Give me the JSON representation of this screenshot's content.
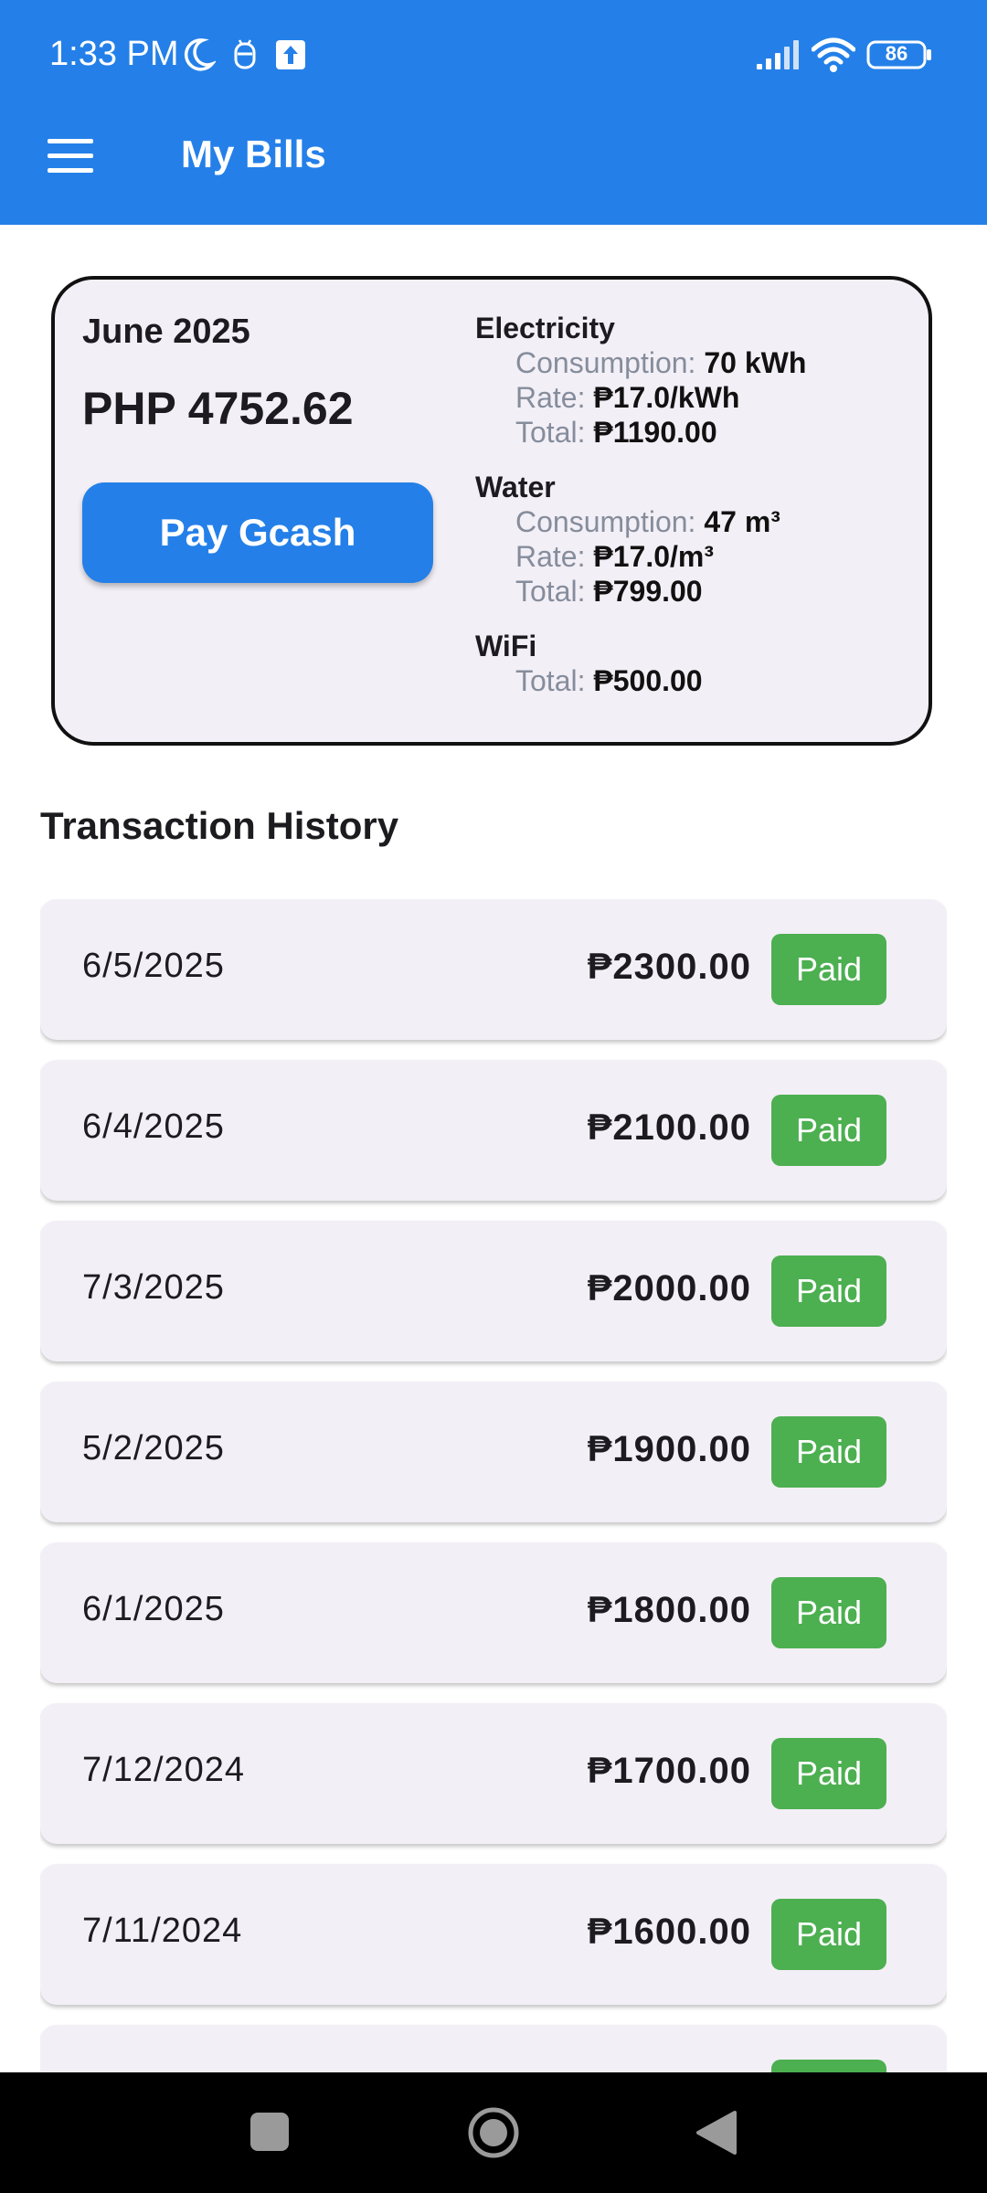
{
  "status_bar": {
    "time": "1:33 PM",
    "battery": "86"
  },
  "app_bar": {
    "title": "My Bills"
  },
  "summary": {
    "month": "June 2025",
    "amount": "PHP 4752.62",
    "pay_button": "Pay Gcash",
    "electricity": {
      "name": "Electricity",
      "consumption_label": "Consumption: ",
      "consumption": "70 kWh",
      "rate_label": "Rate: ",
      "rate": "₱17.0/kWh",
      "total_label": "Total: ",
      "total": "₱1190.00"
    },
    "water": {
      "name": "Water",
      "consumption_label": "Consumption: ",
      "consumption": "47 m³",
      "rate_label": "Rate: ",
      "rate": "₱17.0/m³",
      "total_label": "Total: ",
      "total": "₱799.00"
    },
    "wifi": {
      "name": "WiFi",
      "total_label": "Total: ",
      "total": "₱500.00"
    }
  },
  "history": {
    "title": "Transaction History",
    "rows": [
      {
        "date": "6/5/2025",
        "amount": "₱2300.00",
        "status": "Paid"
      },
      {
        "date": "6/4/2025",
        "amount": "₱2100.00",
        "status": "Paid"
      },
      {
        "date": "7/3/2025",
        "amount": "₱2000.00",
        "status": "Paid"
      },
      {
        "date": "5/2/2025",
        "amount": "₱1900.00",
        "status": "Paid"
      },
      {
        "date": "6/1/2025",
        "amount": "₱1800.00",
        "status": "Paid"
      },
      {
        "date": "7/12/2024",
        "amount": "₱1700.00",
        "status": "Paid"
      },
      {
        "date": "7/11/2024",
        "amount": "₱1600.00",
        "status": "Paid"
      },
      {
        "date": "",
        "amount": "",
        "status": ""
      }
    ]
  },
  "colors": {
    "primary": "#2480e8",
    "card_bg": "#f3eff6",
    "paid": "#4caf50",
    "label_gray": "#858d9c"
  },
  "icons": [
    "moon-icon",
    "bug-icon",
    "upload-icon",
    "signal-icon",
    "wifi-icon",
    "battery-icon",
    "menu-icon",
    "recents-icon",
    "home-icon",
    "back-icon"
  ]
}
